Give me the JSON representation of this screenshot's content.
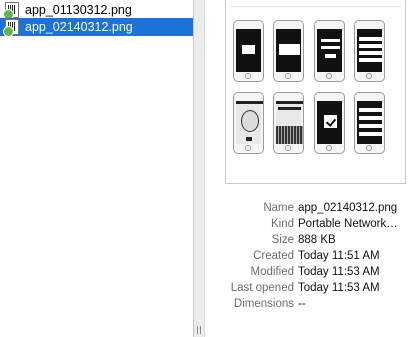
{
  "files": [
    {
      "name": "app_01130312.png",
      "selected": false
    },
    {
      "name": "app_02140312.png",
      "selected": true
    }
  ],
  "preview": {
    "image_name": "app_02140312.png",
    "mockups": [
      "phone-dialog-1",
      "phone-dialog-2",
      "phone-form",
      "phone-list",
      "phone-meme",
      "phone-keyboard",
      "phone-checkmark",
      "phone-menu"
    ]
  },
  "info": {
    "name": {
      "label": "Name",
      "value": "app_02140312.png"
    },
    "kind": {
      "label": "Kind",
      "value": "Portable Network…"
    },
    "size": {
      "label": "Size",
      "value": "888 KB"
    },
    "created": {
      "label": "Created",
      "value": "Today 11:51 AM"
    },
    "modified": {
      "label": "Modified",
      "value": "Today 11:53 AM"
    },
    "last_opened": {
      "label": "Last opened",
      "value": "Today 11:53 AM"
    },
    "dimensions": {
      "label": "Dimensions",
      "value": "--"
    }
  },
  "colors": {
    "selection": "#1d72d9",
    "label": "#6d6d6d"
  }
}
